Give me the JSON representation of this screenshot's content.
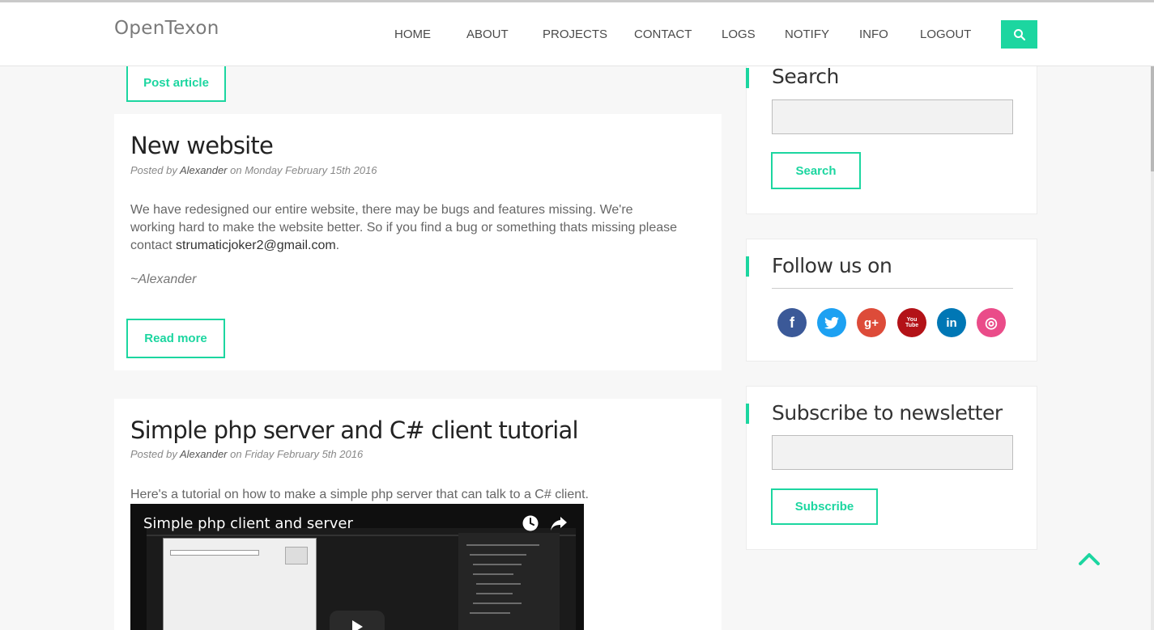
{
  "brand": "OpenTexon",
  "nav": [
    "HOME",
    "ABOUT",
    "PROJECTS",
    "CONTACT",
    "LOGS",
    "NOTIFY",
    "INFO",
    "LOGOUT"
  ],
  "post_article_label": "Post article",
  "posts": [
    {
      "title": "New website",
      "meta_prefix": "Posted by",
      "author": "Alexander",
      "meta_date": "on Monday February 15th 2016",
      "body": "We have redesigned our entire website, there may be bugs and features missing. We're working hard to make the website better. So if you find a bug or something thats missing please contact",
      "email": "strumaticjoker2@gmail.com",
      "body_end": ".",
      "signature": "~Alexander",
      "read_more": "Read more"
    },
    {
      "title": "Simple php server and C# client tutorial",
      "meta_prefix": "Posted by",
      "author": "Alexander",
      "meta_date": "on Friday February 5th 2016",
      "body": "Here's a tutorial on how to make a simple php server that can talk to a C# client.",
      "video_title": "Simple php client and server"
    }
  ],
  "sidebar": {
    "search": {
      "title": "Search",
      "input_value": "",
      "button_label": "Search"
    },
    "follow": {
      "title": "Follow us on",
      "icons": [
        {
          "name": "facebook-icon",
          "glyph": "f",
          "color": "#3b5998"
        },
        {
          "name": "twitter-icon",
          "glyph": "t",
          "color": "#1da1f2"
        },
        {
          "name": "google-plus-icon",
          "glyph": "g+",
          "color": "#dd4b39"
        },
        {
          "name": "youtube-icon",
          "glyph": "You Tube",
          "color": "#b31217"
        },
        {
          "name": "linkedin-icon",
          "glyph": "in",
          "color": "#0077b5"
        },
        {
          "name": "dribbble-icon",
          "glyph": "◎",
          "color": "#ea4c89"
        }
      ]
    },
    "newsletter": {
      "title": "Subscribe to newsletter",
      "input_value": "",
      "button_label": "Subscribe"
    }
  },
  "colors": {
    "accent": "#1cd6a0"
  }
}
